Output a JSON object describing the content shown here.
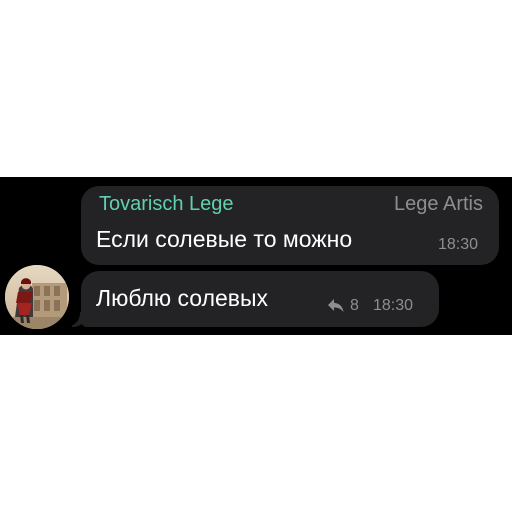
{
  "messages": [
    {
      "sender": "Tovarisch Lege",
      "sender_title": "Lege Artis",
      "text": "Если солевые то можно",
      "time": "18:30"
    },
    {
      "text": "Люблю солевых",
      "reply_count": "8",
      "time": "18:30"
    }
  ],
  "colors": {
    "background": "#000000",
    "bubble": "#232326",
    "sender_name": "#5fd0b0",
    "meta": "#8d8d93",
    "message_text": "#ffffff"
  },
  "icons": {
    "reply": "reply-icon",
    "avatar": "avatar-image"
  }
}
